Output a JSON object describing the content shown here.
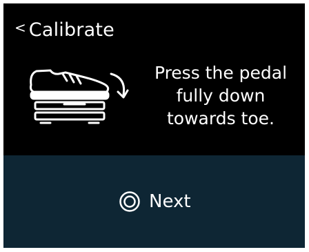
{
  "header": {
    "back_icon": "chevron-left-icon",
    "title": "Calibrate"
  },
  "illustration": {
    "icon": "shoe-on-pedal-rotate-icon"
  },
  "instruction": {
    "lines": [
      "Press the pedal",
      "fully down",
      "towards toe."
    ]
  },
  "action": {
    "icon": "double-circle-icon",
    "label": "Next"
  },
  "colors": {
    "background": "#000000",
    "action_bar": "#0e2634",
    "text": "#ffffff"
  }
}
